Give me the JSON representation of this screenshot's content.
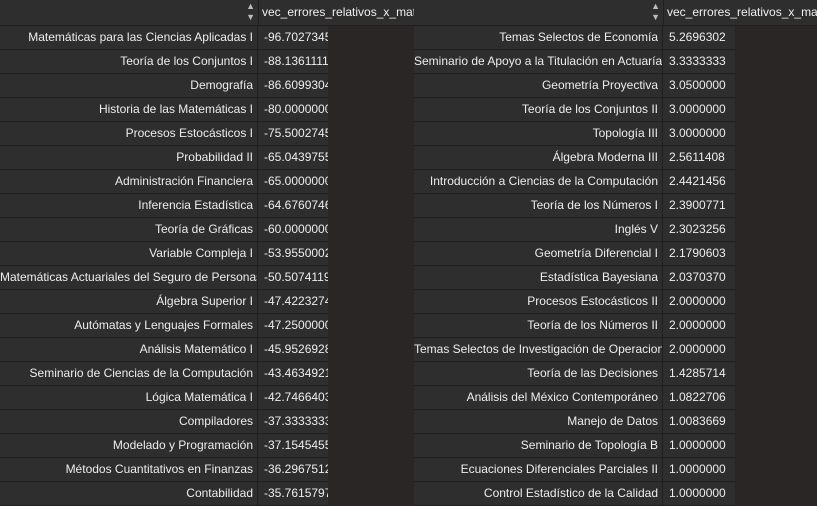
{
  "left_table": {
    "sort_icon": "sort-arrows-icon",
    "column_header": "vec_errores_relativos_x_materia",
    "rows": [
      {
        "name": "Matemáticas para las Ciencias Aplicadas I",
        "value": "-96.7027345"
      },
      {
        "name": "Teoría de los Conjuntos I",
        "value": "-88.1361111"
      },
      {
        "name": "Demografía",
        "value": "-86.6099304"
      },
      {
        "name": "Historia de las Matemáticas I",
        "value": "-80.0000000"
      },
      {
        "name": "Procesos Estocásticos I",
        "value": "-75.5002745"
      },
      {
        "name": "Probabilidad II",
        "value": "-65.0439755"
      },
      {
        "name": "Administración Financiera",
        "value": "-65.0000000"
      },
      {
        "name": "Inferencia Estadística",
        "value": "-64.6760746"
      },
      {
        "name": "Teoría de Gráficas",
        "value": "-60.0000000"
      },
      {
        "name": "Variable Compleja I",
        "value": "-53.9550002"
      },
      {
        "name": "Matemáticas Actuariales del Seguro de Personas II",
        "value": "-50.5074119"
      },
      {
        "name": "Álgebra Superior I",
        "value": "-47.4223274"
      },
      {
        "name": "Autómatas y Lenguajes Formales",
        "value": "-47.2500000"
      },
      {
        "name": "Análisis Matemático I",
        "value": "-45.9526928"
      },
      {
        "name": "Seminario de Ciencias de la Computación",
        "value": "-43.4634921"
      },
      {
        "name": "Lógica Matemática I",
        "value": "-42.7466403"
      },
      {
        "name": "Compiladores",
        "value": "-37.3333333"
      },
      {
        "name": "Modelado y Programación",
        "value": "-37.1545455"
      },
      {
        "name": "Métodos Cuantitativos en Finanzas",
        "value": "-36.2967512"
      },
      {
        "name": "Contabilidad",
        "value": "-35.7615797"
      }
    ]
  },
  "right_table": {
    "sort_icon": "sort-arrows-icon",
    "column_header": "vec_errores_relativos_x_materia",
    "rows": [
      {
        "name": "Temas Selectos de Economía",
        "value": "5.2696302"
      },
      {
        "name": "Seminario de Apoyo a la Titulación en Actuaría A",
        "value": "3.3333333"
      },
      {
        "name": "Geometría Proyectiva",
        "value": "3.0500000"
      },
      {
        "name": "Teoría de los Conjuntos II",
        "value": "3.0000000"
      },
      {
        "name": "Topología III",
        "value": "3.0000000"
      },
      {
        "name": "Álgebra Moderna III",
        "value": "2.5611408"
      },
      {
        "name": "Introducción a Ciencias de la Computación",
        "value": "2.4421456"
      },
      {
        "name": "Teoría de los Números I",
        "value": "2.3900771"
      },
      {
        "name": "Inglés V",
        "value": "2.3023256"
      },
      {
        "name": "Geometría Diferencial I",
        "value": "2.1790603"
      },
      {
        "name": "Estadística Bayesiana",
        "value": "2.0370370"
      },
      {
        "name": "Procesos Estocásticos II",
        "value": "2.0000000"
      },
      {
        "name": "Teoría de los Números II",
        "value": "2.0000000"
      },
      {
        "name": "Temas Selectos de Investigación de Operaciones",
        "value": "2.0000000"
      },
      {
        "name": "Teoría de las Decisiones",
        "value": "1.4285714"
      },
      {
        "name": "Análisis del México Contemporáneo",
        "value": "1.0822706"
      },
      {
        "name": "Manejo de Datos",
        "value": "1.0083669"
      },
      {
        "name": "Seminario de Topología B",
        "value": "1.0000000"
      },
      {
        "name": "Ecuaciones Diferenciales Parciales II",
        "value": "1.0000000"
      },
      {
        "name": "Control Estadístico de la Calidad",
        "value": "1.0000000"
      }
    ]
  }
}
